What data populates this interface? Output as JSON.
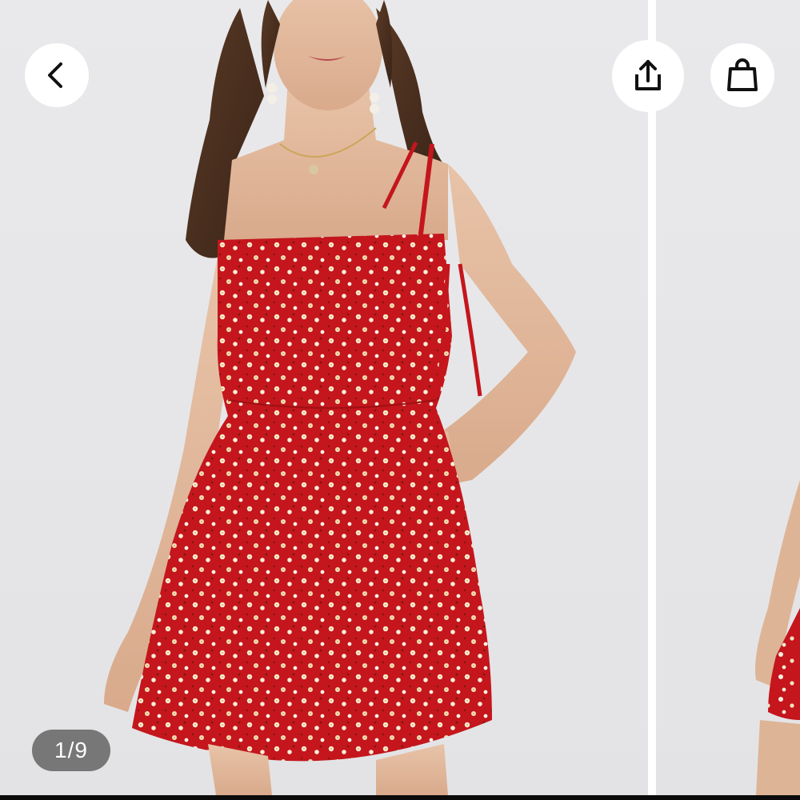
{
  "gallery": {
    "counter_text": "1/9",
    "current_index": 1,
    "total": 9
  },
  "toolbar": {
    "back_icon": "chevron-left-icon",
    "share_icon": "share-icon",
    "bag_icon": "shopping-bag-icon"
  },
  "colors": {
    "background": "#e6e6e8",
    "dress": "#c4161c",
    "button_bg": "#ffffff",
    "counter_bg": "#5f5f5f"
  }
}
